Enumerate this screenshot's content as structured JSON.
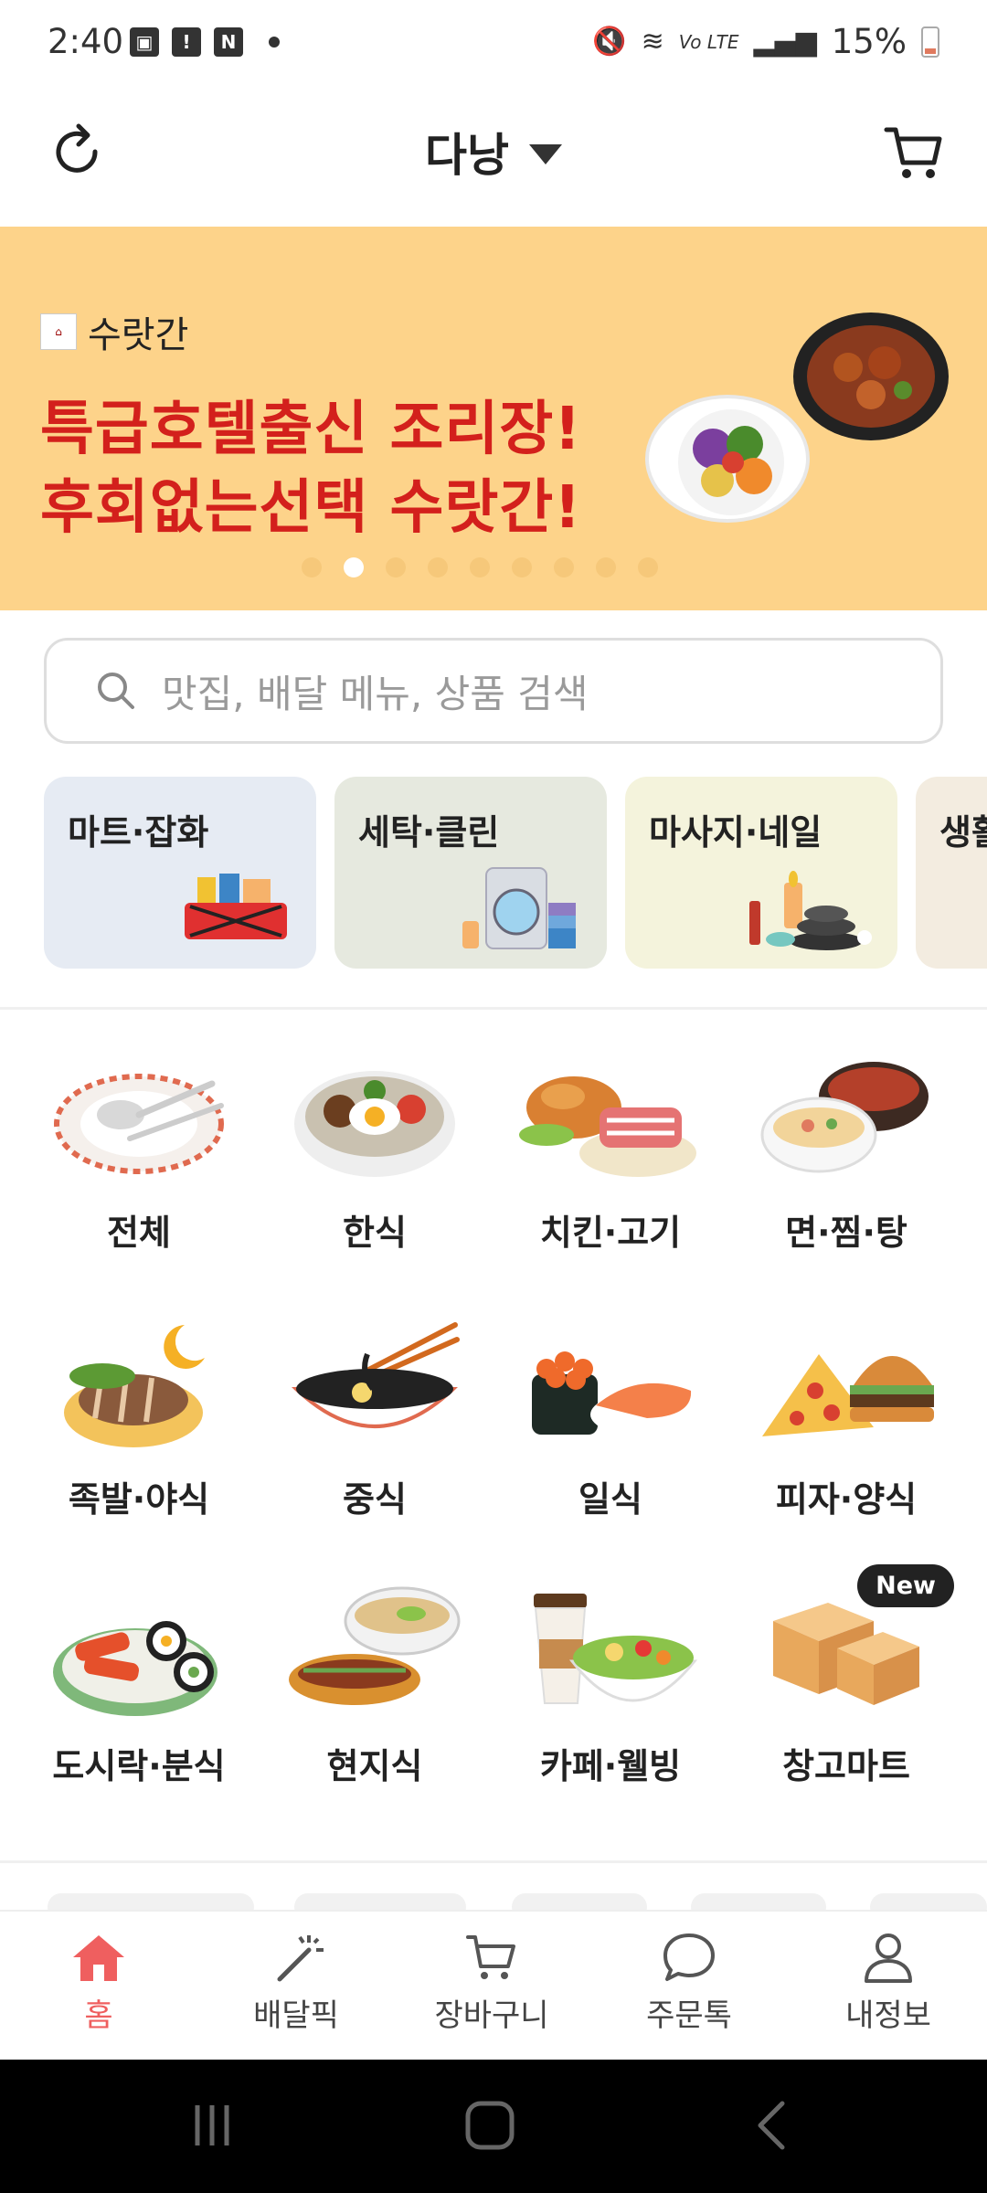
{
  "status": {
    "time": "2:40",
    "battery": "15%",
    "network": "Vo LTE"
  },
  "header": {
    "location": "다낭"
  },
  "banner": {
    "brand": "수랏간",
    "line1": "특급호텔출신 조리장!",
    "line2": "후회없는선택 수랏간!",
    "active_slide": 2,
    "slide_count": 9
  },
  "search": {
    "placeholder": "맛집, 배달 메뉴, 상품 검색"
  },
  "quick_categories": [
    {
      "label": "마트·잡화",
      "bg": "#e6ebf3"
    },
    {
      "label": "세탁·클린",
      "bg": "#e6e9df"
    },
    {
      "label": "마사지·네일",
      "bg": "#f4f3dc"
    },
    {
      "label": "생활",
      "bg": "#f3ece0"
    }
  ],
  "categories": [
    {
      "label": "전체"
    },
    {
      "label": "한식"
    },
    {
      "label": "치킨·고기"
    },
    {
      "label": "면·찜·탕"
    },
    {
      "label": "족발·야식"
    },
    {
      "label": "중식"
    },
    {
      "label": "일식"
    },
    {
      "label": "피자·양식"
    },
    {
      "label": "도시락·분식"
    },
    {
      "label": "현지식"
    },
    {
      "label": "카페·웰빙"
    },
    {
      "label": "창고마트",
      "badge": "New"
    }
  ],
  "tabs": [
    {
      "label": "홈",
      "icon": "home-icon",
      "active": true
    },
    {
      "label": "배달픽",
      "icon": "magic-wand-icon"
    },
    {
      "label": "장바구니",
      "icon": "cart-icon"
    },
    {
      "label": "주문톡",
      "icon": "chat-bubble-icon"
    },
    {
      "label": "내정보",
      "icon": "person-icon"
    }
  ],
  "colors": {
    "accent": "#ef5f5f",
    "banner_bg": "#fdd38a",
    "banner_text": "#d3201c"
  }
}
